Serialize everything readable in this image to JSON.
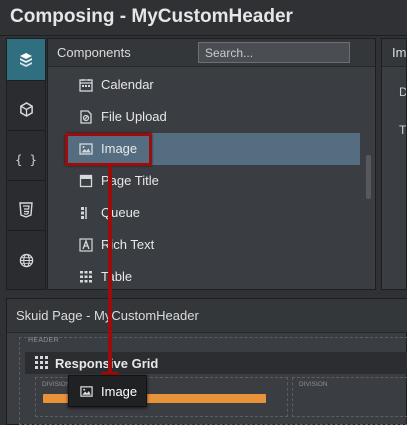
{
  "window": {
    "title": "Composing - MyCustomHeader"
  },
  "rail": {
    "items": [
      {
        "icon": "cube-stack-icon",
        "active": true
      },
      {
        "icon": "cube-icon",
        "active": false
      },
      {
        "icon": "braces-icon",
        "label": "{ }",
        "active": false
      },
      {
        "icon": "css3-icon",
        "active": false
      },
      {
        "icon": "globe-icon",
        "active": false
      }
    ]
  },
  "components": {
    "title": "Components",
    "search_placeholder": "Search...",
    "items": [
      {
        "label": "Calendar",
        "icon": "calendar-icon"
      },
      {
        "label": "File Upload",
        "icon": "file-upload-icon"
      },
      {
        "label": "Image",
        "icon": "image-icon",
        "selected": true
      },
      {
        "label": "Page Title",
        "icon": "page-title-icon"
      },
      {
        "label": "Queue",
        "icon": "queue-icon"
      },
      {
        "label": "Rich Text",
        "icon": "rich-text-icon"
      },
      {
        "label": "Table",
        "icon": "table-icon"
      }
    ]
  },
  "properties": {
    "tab_label": "Im",
    "line1": "D",
    "line2": "T"
  },
  "page": {
    "title": "Skuid Page - MyCustomHeader",
    "header_region_label": "HEADER",
    "grid_label": "Responsive Grid",
    "division_label": "DIVISION"
  },
  "drag": {
    "label": "Image",
    "icon": "image-icon"
  },
  "colors": {
    "accent_teal": "#2f6f7f",
    "selection": "#556d80",
    "highlight_red": "#9b0c0c",
    "drop_indicator": "#e8923a"
  }
}
